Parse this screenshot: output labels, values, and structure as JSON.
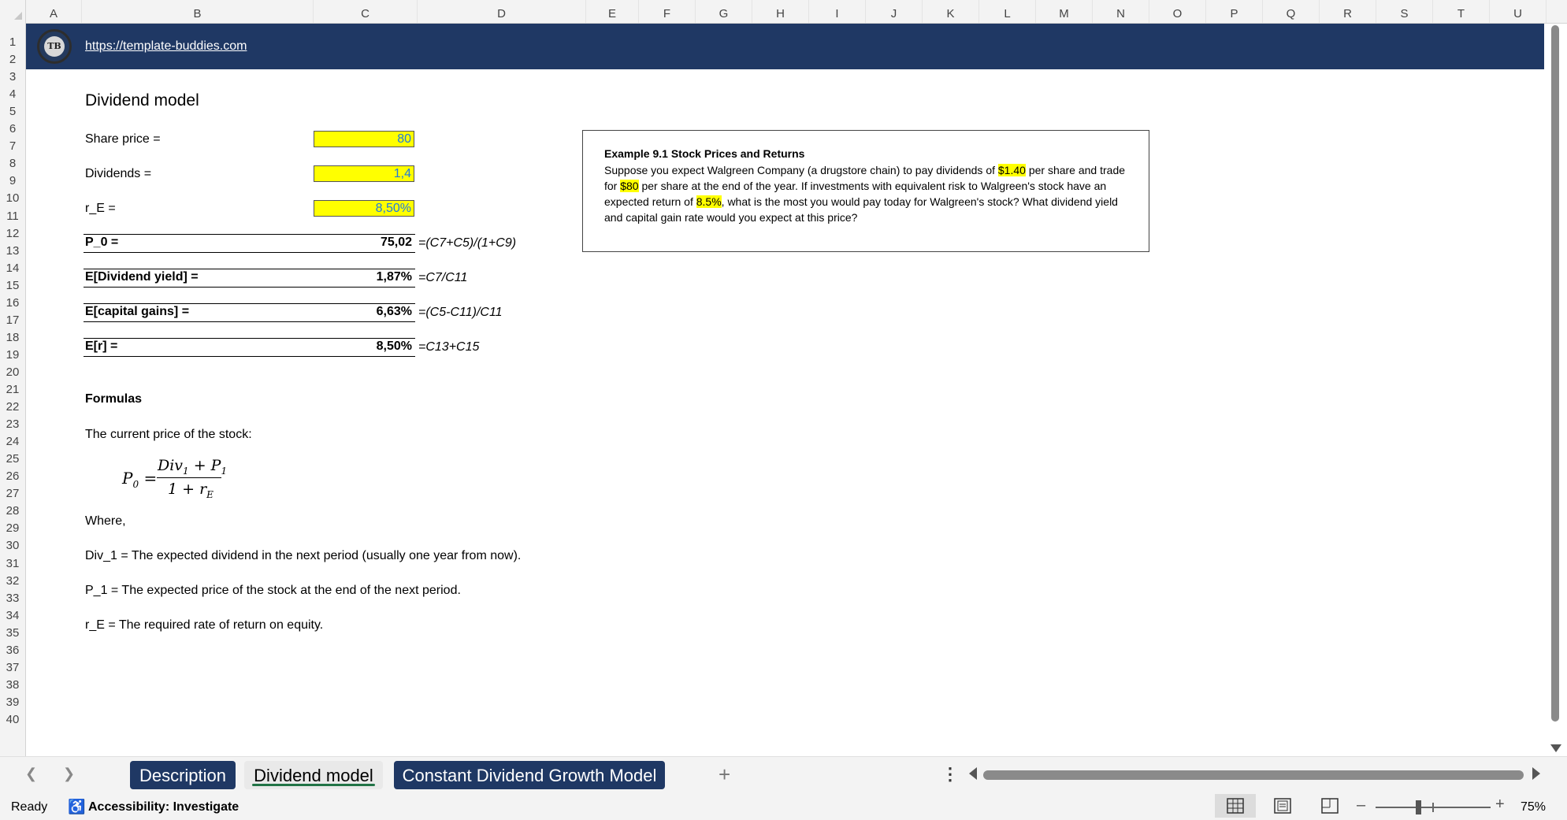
{
  "columns": [
    "A",
    "B",
    "C",
    "D",
    "E",
    "F",
    "G",
    "H",
    "I",
    "J",
    "K",
    "L",
    "M",
    "N",
    "O",
    "P",
    "Q",
    "R",
    "S",
    "T",
    "U"
  ],
  "rows": [
    "1",
    "2",
    "3",
    "4",
    "5",
    "6",
    "7",
    "8",
    "9",
    "10",
    "11",
    "12",
    "13",
    "14",
    "15",
    "16",
    "17",
    "18",
    "19",
    "20",
    "21",
    "22",
    "23",
    "24",
    "25",
    "26",
    "27",
    "28",
    "29",
    "30",
    "31",
    "32",
    "33",
    "34",
    "35",
    "36",
    "37",
    "38",
    "39",
    "40"
  ],
  "banner": {
    "logo_text": "TB",
    "link": "https://template-buddies.com"
  },
  "sheet": {
    "title": "Dividend model",
    "inputs": [
      {
        "label": "Share price =",
        "value": "80"
      },
      {
        "label": "Dividends =",
        "value": "1,4"
      },
      {
        "label": "r_E =",
        "value": "8,50%"
      }
    ],
    "results": [
      {
        "label": "P_0 =",
        "value": "75,02",
        "formula": "=(C7+C5)/(1+C9)"
      },
      {
        "label": "E[Dividend yield] =",
        "value": "1,87%",
        "formula": "=C7/C11"
      },
      {
        "label": "E[capital gains] =",
        "value": "6,63%",
        "formula": "=(C5-C11)/C11"
      },
      {
        "label": "E[r] =",
        "value": "8,50%",
        "formula": "=C13+C15"
      }
    ],
    "formulas_heading": "Formulas",
    "current_price_text": "The current price of the stock:",
    "equation": {
      "lhs": "P",
      "lhs_sub": "0",
      "num_a": "Div",
      "num_a_sub": "1",
      "num_op": " + P",
      "num_b_sub": "1",
      "den": "1 + r",
      "den_sub": "E"
    },
    "where": "Where,",
    "definitions": [
      "Div_1 = The expected dividend in the next period (usually one year from now).",
      "P_1 = The expected price of the stock at the end of the next period.",
      "r_E = The required rate of return on equity."
    ]
  },
  "example": {
    "title": "Example 9.1 Stock Prices and Returns",
    "p1": "Suppose you expect Walgreen Company (a drugstore chain) to pay dividends of ",
    "h1": "$1.40",
    "p2": " per share and trade for ",
    "h2": "$80",
    "p3": " per share at the end of the year. If investments with equivalent risk to Walgreen's stock have an expected return of ",
    "h3": "8.5%",
    "p4": ", what is the most you would pay today for Walgreen's stock? What dividend yield and capital gain rate would you expect at this price?"
  },
  "tabs": {
    "description": "Description",
    "dividend_model": "Dividend model",
    "constant_growth": "Constant Dividend Growth Model",
    "add": "+",
    "more": "⋮"
  },
  "status": {
    "ready": "Ready",
    "accessibility": "Accessibility: Investigate",
    "zoom": "75%"
  }
}
